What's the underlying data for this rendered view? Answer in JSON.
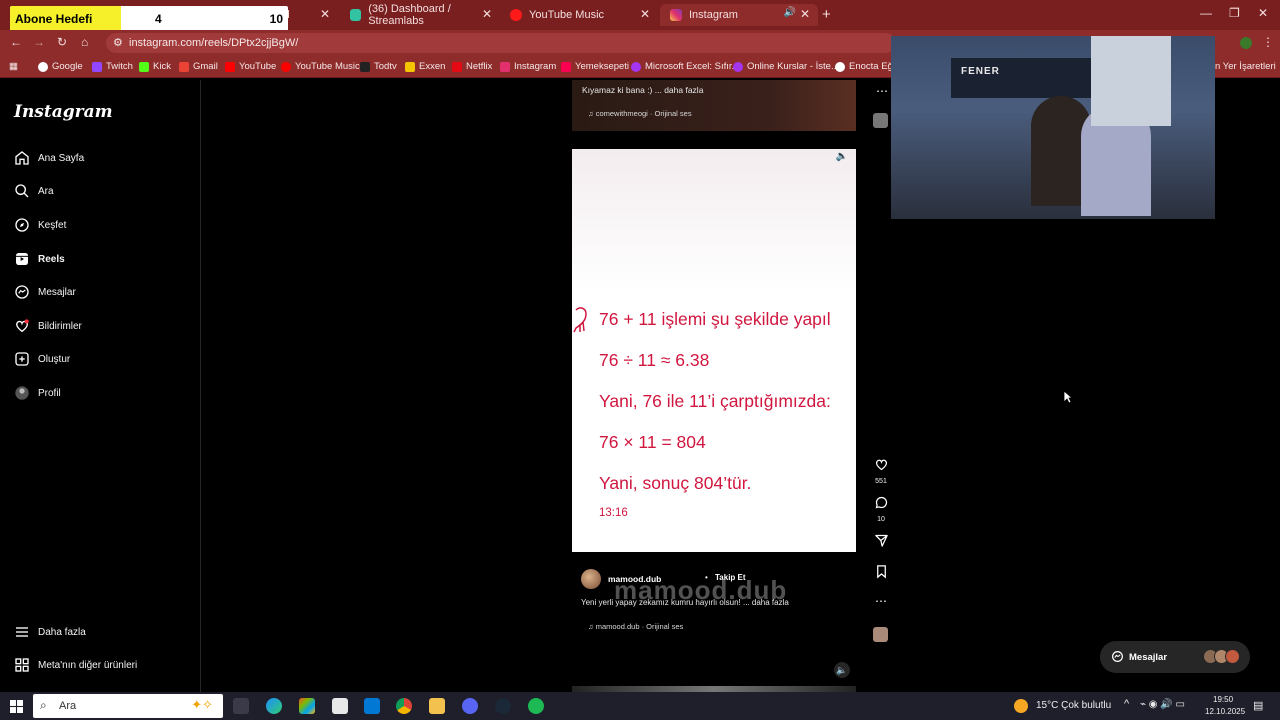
{
  "browser": {
    "tabs": [
      {
        "label": "rd",
        "active": false
      },
      {
        "label": "(36) Dashboard / Streamlabs",
        "active": false
      },
      {
        "label": "YouTube Music",
        "active": false
      },
      {
        "label": "Instagram",
        "active": true
      }
    ],
    "url": "instagram.com/reels/DPtx2cjjBgW/",
    "bookmarks": [
      "Google",
      "Twitch",
      "Kick",
      "Gmail",
      "YouTube",
      "YouTube Music",
      "Todtv",
      "Exxen",
      "Netflix",
      "Instagram",
      "Yemeksepeti",
      "Microsoft Excel: Sıfır...",
      "Online Kurslar - İste...",
      "Enocta Eğit",
      "n Yer İşaretleri"
    ]
  },
  "goal_overlay": {
    "label": "Abone Hedefi",
    "current": "4",
    "target": "10",
    "progress_fraction": 0.4
  },
  "sidebar": {
    "logo": "Instagram",
    "items": [
      {
        "label": "Ana Sayfa",
        "icon": "home-icon"
      },
      {
        "label": "Ara",
        "icon": "search-icon"
      },
      {
        "label": "Keşfet",
        "icon": "compass-icon"
      },
      {
        "label": "Reels",
        "icon": "reels-icon"
      },
      {
        "label": "Mesajlar",
        "icon": "messenger-icon"
      },
      {
        "label": "Bildirimler",
        "icon": "heart-icon"
      },
      {
        "label": "Oluştur",
        "icon": "plus-square-icon"
      },
      {
        "label": "Profil",
        "icon": "profile-avatar"
      }
    ],
    "more": "Daha fazla",
    "meta": "Meta'nın diğer ürünleri"
  },
  "prev_post": {
    "caption": "Kıyamaz ki bana :) ... daha fazla",
    "audio": "comewithmeogi · Orijinal ses"
  },
  "reel": {
    "lines": [
      "76 + 11 işlemi şu şekilde yapıl",
      "76 ÷ 11 ≈ 6.38",
      "Yani, 76 ile 11’i çarptığımızda:",
      "76 × 11 = 804",
      "Yani, sonuç 804’tür."
    ],
    "timestamp": "13:16"
  },
  "post": {
    "author": "mamood.dub",
    "follow": "Takip Et",
    "watermark": "mamood.dub",
    "caption": "Yeni yerli yapay zekamız kumru hayırlı olsun! ... daha fazla",
    "audio": "mamood.dub · Orijinal ses",
    "likes": "551",
    "comments": "10"
  },
  "messages_pill": {
    "label": "Mesajlar"
  },
  "webcam": {
    "banner": "FENER"
  },
  "taskbar": {
    "search_placeholder": "Ara",
    "weather": "15°C  Çok bulutlu",
    "time": "19:50",
    "date": "12.10.2025"
  },
  "colors": {
    "chrome_tabstrip": "#7a1f1f",
    "chrome_toolbar": "#8e2b2b",
    "reel_text": "#d1163f",
    "goal_fill": "#f5f02a"
  }
}
